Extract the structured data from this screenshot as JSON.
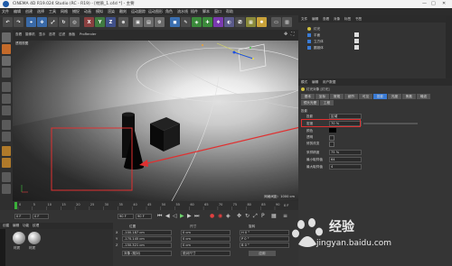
{
  "app": {
    "title": "CINEMA 4D R19.024 Studio (RC - R19) - [材质_1.c4d *] - 主要",
    "window_controls": [
      "—",
      "□",
      "✕"
    ]
  },
  "menu": [
    "文件",
    "编辑",
    "创建",
    "选择",
    "工具",
    "网格",
    "捕捉",
    "动画",
    "模拟",
    "渲染",
    "雕刻",
    "运动跟踪",
    "运动图形",
    "角色",
    "流水线",
    "插件",
    "脚本",
    "窗口",
    "帮助"
  ],
  "viewport": {
    "menu": [
      "查看",
      "摄像机",
      "显示",
      "选项",
      "过滤",
      "面板",
      "ProRender"
    ],
    "label": "透视视图",
    "grid_info": "网格间距：1000 cm"
  },
  "objects": {
    "tabs": [
      "文件",
      "编辑",
      "查看",
      "对象",
      "标签",
      "书签"
    ],
    "items": [
      "灯光",
      "平面",
      "立方体",
      "圆锥体"
    ]
  },
  "attributes": {
    "header": [
      "模式",
      "编辑",
      "用户数据"
    ],
    "object_label": "灯光对象 [灯光]",
    "tabs": [
      "基本",
      "坐标",
      "常规",
      "细节",
      "可见",
      "投影",
      "光度",
      "焦散",
      "噪波",
      "镜头光晕",
      "工程"
    ],
    "section": "投影",
    "fields": [
      {
        "label": "投影",
        "value": "区域"
      },
      {
        "label": "密度",
        "value": "70 %"
      },
      {
        "label": "颜色",
        "value": ""
      },
      {
        "label": "透明",
        "value": ""
      },
      {
        "label": "修剪改变",
        "value": ""
      },
      {
        "label": "采样精度",
        "value": "75 %"
      },
      {
        "label": "最小取样值",
        "value": "64"
      },
      {
        "label": "最大取样值",
        "value": "4"
      }
    ]
  },
  "timeline": {
    "ticks": [
      "0",
      "5",
      "10",
      "15",
      "20",
      "25",
      "30",
      "35",
      "40",
      "45",
      "50",
      "55",
      "60",
      "65",
      "70",
      "75",
      "80",
      "85",
      "90"
    ],
    "frame_end": "0 F"
  },
  "controls": {
    "start": "0 F",
    "current": "0 F",
    "end": "90 F",
    "end2": "90 F"
  },
  "coords": {
    "headers": [
      "位置",
      "尺寸",
      "旋转"
    ],
    "rows": [
      {
        "axis": "X",
        "pos": "-100.187 cm",
        "size": "0 cm",
        "rot": "H 0 °"
      },
      {
        "axis": "Y",
        "pos": "-170.145 cm",
        "size": "0 cm",
        "rot": "P 0 °"
      },
      {
        "axis": "Z",
        "pos": "-150.321 cm",
        "size": "0 cm",
        "rot": "B 0 °"
      }
    ],
    "mode": "对象 (相对)",
    "size_mode": "绝对尺寸",
    "apply": "应用"
  },
  "materials": {
    "menu": [
      "创建",
      "编辑",
      "功能",
      "纹理"
    ],
    "items": [
      "材质",
      "材质"
    ]
  },
  "watermark": {
    "brand": "Baidu",
    "text": "经验",
    "url": "jingyan.baidu.com"
  },
  "colors": {
    "annotation": "#e03030",
    "accent": "#3a7bd5"
  }
}
